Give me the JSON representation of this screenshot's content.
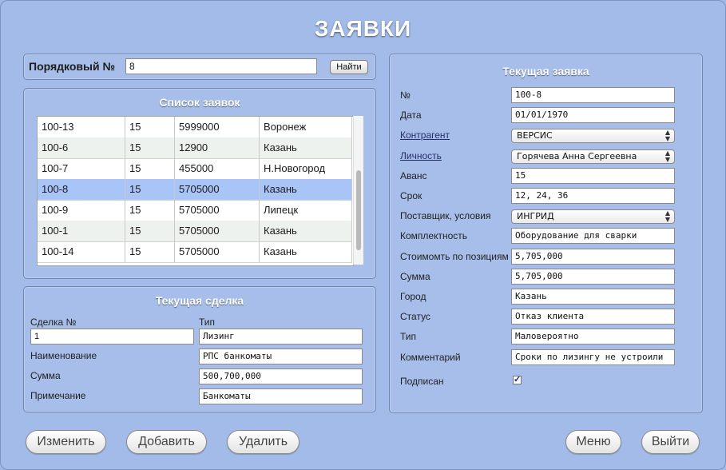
{
  "title": "ЗАЯВКИ",
  "search": {
    "label": "Порядковый №",
    "value": "8",
    "button": "Найти"
  },
  "list": {
    "title": "Список заявок",
    "rows": [
      [
        "100-13",
        "15",
        "5999000",
        "Воронеж"
      ],
      [
        "100-6",
        "15",
        "12900",
        "Казань"
      ],
      [
        "100-7",
        "15",
        "455000",
        "Н.Новогород"
      ],
      [
        "100-8",
        "15",
        "5705000",
        "Казань"
      ],
      [
        "100-9",
        "15",
        "5705000",
        "Липецк"
      ],
      [
        "100-1",
        "15",
        "5705000",
        "Казань"
      ],
      [
        "100-14",
        "15",
        "5705000",
        "Казань"
      ]
    ]
  },
  "deal": {
    "title": "Текущая сделка",
    "number_label": "Сделка №",
    "number_value": "1",
    "type_label": "Тип",
    "type_value": "Лизинг",
    "name_label": "Наименование",
    "name_value": "РПС банкоматы",
    "sum_label": "Сумма",
    "sum_value": "500,700,000",
    "note_label": "Примечание",
    "note_value": "Банкоматы"
  },
  "request": {
    "title": "Текущая заявка",
    "fields": [
      {
        "label": "№",
        "value": "100-8",
        "kind": "text"
      },
      {
        "label": "Дата",
        "value": "01/01/1970",
        "kind": "text"
      },
      {
        "label": "Контрагент",
        "value": "ВЕРСИС",
        "kind": "select"
      },
      {
        "label": "Личность",
        "value": "Горячева Анна Сергеевна",
        "kind": "select"
      },
      {
        "label": "Аванс",
        "value": "15",
        "kind": "text"
      },
      {
        "label": "Срок",
        "value": "12, 24, 36",
        "kind": "text"
      },
      {
        "label": "Поставщик, условия",
        "value": "ИНГРИД",
        "kind": "select"
      },
      {
        "label": "Комплектность",
        "value": "Оборудование для сварки",
        "kind": "text"
      },
      {
        "label": "Стоимомть по позициям",
        "value": "5,705,000",
        "kind": "text"
      },
      {
        "label": "Сумма",
        "value": "5,705,000",
        "kind": "text"
      },
      {
        "label": "Город",
        "value": "Казань",
        "kind": "text"
      },
      {
        "label": "Статус",
        "value": "Отказ клиента",
        "kind": "text"
      },
      {
        "label": "Тип",
        "value": "Маловероятно",
        "kind": "text"
      },
      {
        "label": "Комментарий",
        "value": "Сроки по лизингу не устроили",
        "kind": "text"
      }
    ],
    "signed_label": "Подписан",
    "signed": true
  },
  "buttons": {
    "edit": "Изменить",
    "add": "Добавить",
    "delete": "Удалить",
    "menu": "Меню",
    "exit": "Выйти"
  },
  "icons": {
    "dropdown": "updown-arrows-icon",
    "checkbox": "checkmark-icon"
  }
}
